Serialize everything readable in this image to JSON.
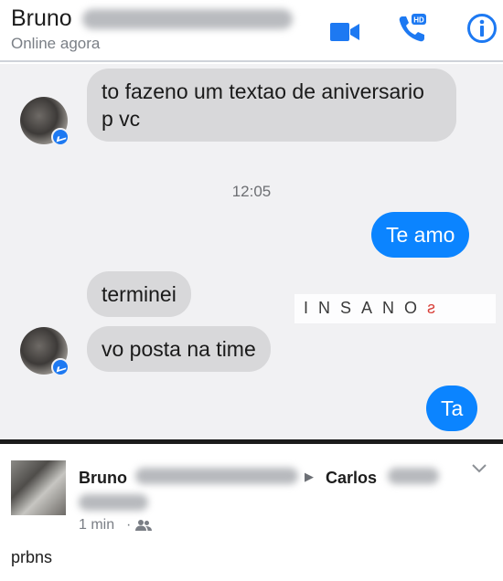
{
  "header": {
    "contact_name": "Bruno",
    "status": "Online agora",
    "icons": [
      "video-call-icon",
      "voice-call-hd-icon",
      "info-icon"
    ],
    "accent_color": "#1d79f2"
  },
  "chat": {
    "messages": [
      {
        "direction": "in",
        "text": "to fazeno um textao de aniversario p vc"
      },
      {
        "direction": "out",
        "text": "Te amo"
      },
      {
        "direction": "in",
        "text": "terminei"
      },
      {
        "direction": "in",
        "text": "vo posta na time"
      },
      {
        "direction": "out",
        "text": "Ta"
      }
    ],
    "timestamp": "12:05",
    "bubble_in_color": "#d8d8da",
    "bubble_out_color": "#0b84ff"
  },
  "watermark": {
    "text": "INSANO",
    "end_glyph": "ƨ"
  },
  "post": {
    "author": "Bruno",
    "recipient": "Carlos",
    "time": "1 min",
    "separator": "·",
    "audience_icon": "friends-icon",
    "text": "prbns"
  }
}
